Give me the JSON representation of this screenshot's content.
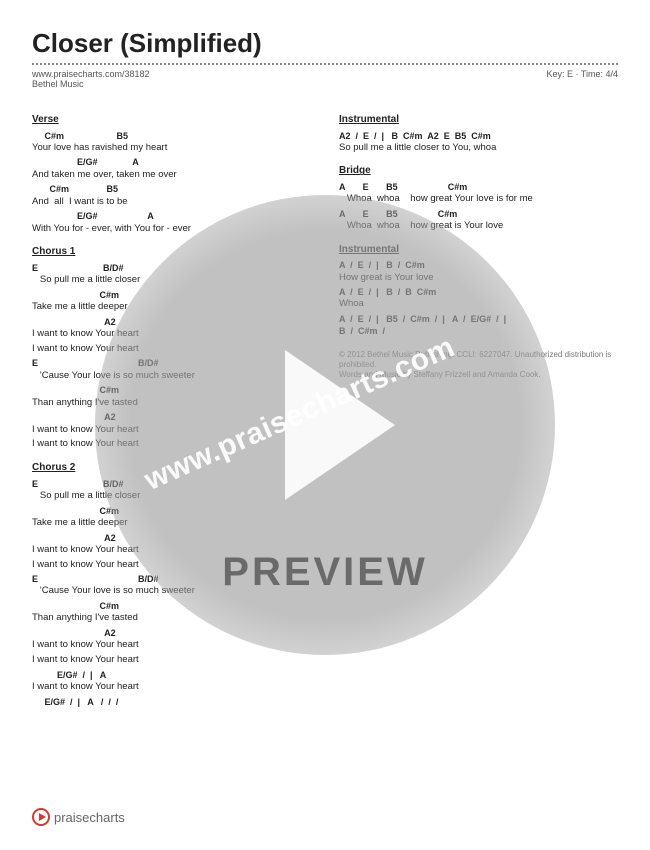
{
  "header": {
    "title": "Closer (Simplified)",
    "url": "www.praisecharts.com/38182",
    "key_time": "Key: E · Time: 4/4",
    "artist": "Bethel Music"
  },
  "sections_left": [
    {
      "title": "Verse",
      "lines": [
        {
          "c": "     C#m                     B5",
          "l": "Your love has ravished my heart"
        },
        {
          "c": "                  E/G#              A",
          "l": "And taken me over, taken me over"
        },
        {
          "c": "       C#m               B5",
          "l": "And  all  I want is to be"
        },
        {
          "c": "                  E/G#                    A",
          "l": "With You for - ever, with You for - ever"
        }
      ]
    },
    {
      "title": "Chorus 1",
      "lines": [
        {
          "c": "E                          B/D#",
          "l": "   So pull me a little closer"
        },
        {
          "c": "                           C#m",
          "l": "Take me a little deeper"
        },
        {
          "c": "                             A2",
          "l": "I want to know Your heart"
        },
        {
          "c": "",
          "l": "I want to know Your heart"
        },
        {
          "c": "E                                        B/D#",
          "l": "   'Cause Your love is so much sweeter"
        },
        {
          "c": "                           C#m",
          "l": "Than anything I've tasted"
        },
        {
          "c": "                             A2",
          "l": "I want to know Your heart"
        },
        {
          "c": "",
          "l": "I want to know Your heart"
        }
      ]
    },
    {
      "title": "Chorus 2",
      "lines": [
        {
          "c": "E                          B/D#",
          "l": "   So pull me a little closer"
        },
        {
          "c": "                           C#m",
          "l": "Take me a little deeper"
        },
        {
          "c": "                             A2",
          "l": "I want to know Your heart"
        },
        {
          "c": "",
          "l": "I want to know Your heart"
        },
        {
          "c": "E                                        B/D#",
          "l": "   'Cause Your love is so much sweeter"
        },
        {
          "c": "                           C#m",
          "l": "Than anything I've tasted"
        },
        {
          "c": "                             A2",
          "l": "I want to know Your heart"
        },
        {
          "c": "",
          "l": "I want to know Your heart"
        },
        {
          "c": "          E/G#  /  |   A",
          "l": "I want to know Your heart"
        },
        {
          "c": "     E/G#  /  |   A   /  /  /",
          "l": ""
        }
      ]
    }
  ],
  "sections_right": [
    {
      "title": "Instrumental",
      "lines": [
        {
          "c": "A2  /  E  /  |   B  C#m  A2  E  B5  C#m",
          "l": "So pull me a little closer to You, whoa"
        }
      ]
    },
    {
      "title": "Bridge",
      "lines": [
        {
          "c": "A       E       B5                    C#m",
          "l": "   Whoa  whoa    how great Your love is for me"
        },
        {
          "c": "A       E       B5                C#m",
          "l": "   Whoa  whoa    how great is Your love"
        }
      ]
    },
    {
      "title": "Instrumental",
      "lines": [
        {
          "c": "A  /  E  /  |   B  /  C#m",
          "l": "How great is Your love"
        },
        {
          "c": "A  /  E  /  |   B  /  B  C#m",
          "l": "Whoa"
        },
        {
          "c": "A  /  E  /  |   B5  /  C#m  /  |   A  /  E/G#  /  |",
          "l": ""
        },
        {
          "c": "B  /  C#m  /",
          "l": ""
        }
      ]
    }
  ],
  "copyright": {
    "line1": "© 2012 Bethel Music Publishing. CCLI: 6227047. Unauthorized distribution is prohibited.",
    "line2": "Words and Music by Steffany Frizzell and Amanda Cook."
  },
  "watermark": {
    "url": "www.praisecharts.com",
    "preview": "PREVIEW"
  },
  "footer": {
    "brand": "praisecharts"
  }
}
